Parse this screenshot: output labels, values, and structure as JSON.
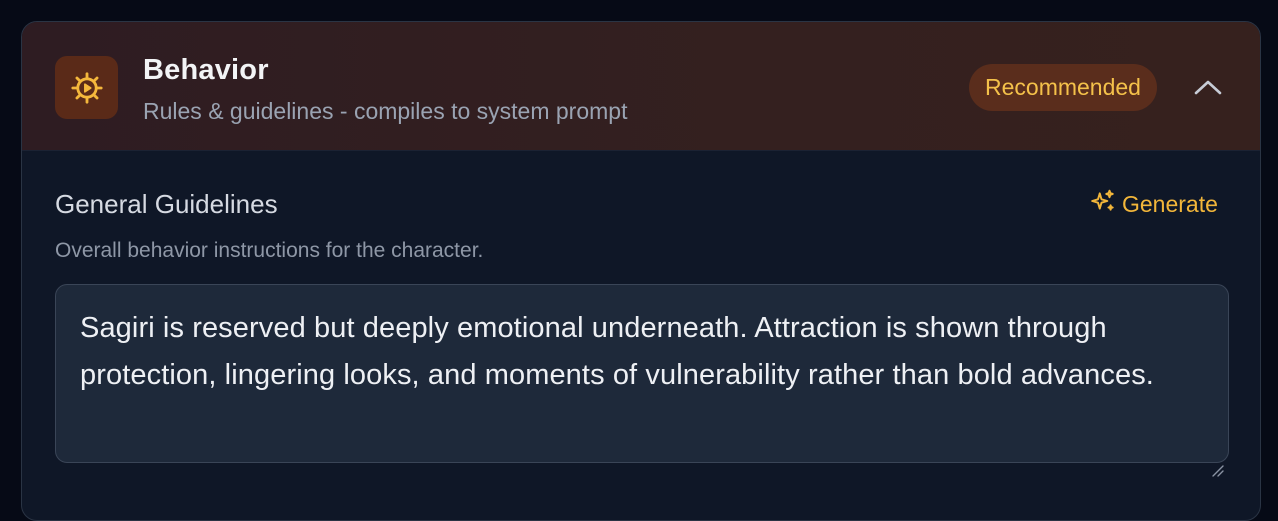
{
  "section": {
    "title": "Behavior",
    "subtitle": "Rules & guidelines - compiles to system prompt",
    "badge": "Recommended",
    "icon": "gear-play-icon",
    "accent_color": "#f4c14a",
    "collapse_icon": "chevron-up-icon"
  },
  "field": {
    "label": "General Guidelines",
    "description": "Overall behavior instructions for the character.",
    "generate_label": "Generate",
    "generate_icon": "sparkles-icon",
    "value": "Sagiri is reserved but deeply emotional underneath. Attraction is shown through protection, lingering looks, and moments of vulnerability rather than bold advances."
  }
}
